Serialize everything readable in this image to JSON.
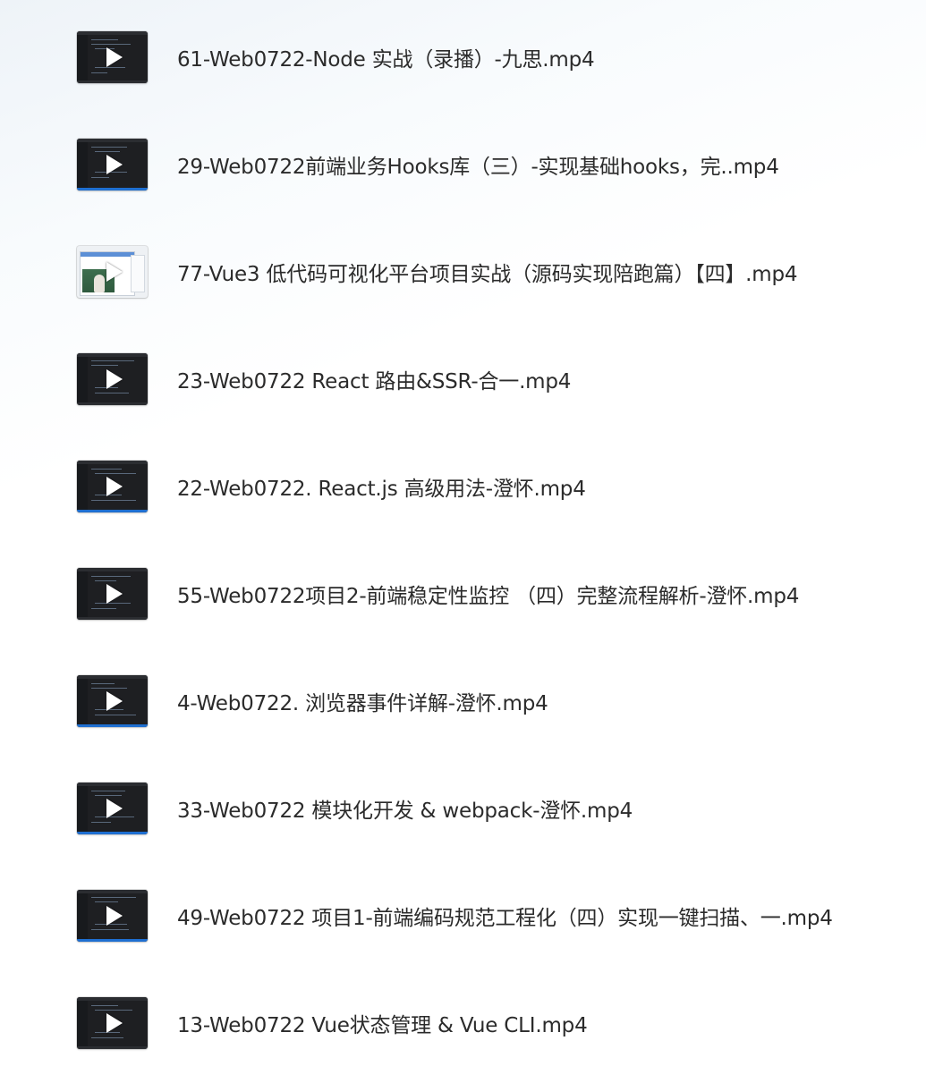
{
  "files": [
    {
      "name": "61-Web0722-Node 实战（录播）-九思.mp4",
      "thumbnail": "code-editor",
      "icon": "play-icon"
    },
    {
      "name": "29-Web0722前端业务Hooks库（三）-实现基础hooks，完..mp4",
      "thumbnail": "code-editor",
      "icon": "play-icon"
    },
    {
      "name": "77-Vue3 低代码可视化平台项目实战（源码实现陪跑篇）【四】.mp4",
      "thumbnail": "browser-with-webcam",
      "icon": "play-icon"
    },
    {
      "name": "23-Web0722 React 路由&SSR-合一.mp4",
      "thumbnail": "code-editor",
      "icon": "play-icon"
    },
    {
      "name": "22-Web0722. React.js 高级用法-澄怀.mp4",
      "thumbnail": "code-editor",
      "icon": "play-icon"
    },
    {
      "name": "55-Web0722项目2-前端稳定性监控 （四）完整流程解析-澄怀.mp4",
      "thumbnail": "code-editor",
      "icon": "play-icon"
    },
    {
      "name": "4-Web0722. 浏览器事件详解-澄怀.mp4",
      "thumbnail": "code-editor",
      "icon": "play-icon"
    },
    {
      "name": "33-Web0722 模块化开发 & webpack-澄怀.mp4",
      "thumbnail": "code-editor",
      "icon": "play-icon"
    },
    {
      "name": "49-Web0722 项目1-前端编码规范工程化（四）实现一键扫描、一.mp4",
      "thumbnail": "code-editor",
      "icon": "play-icon"
    },
    {
      "name": "13-Web0722 Vue状态管理 & Vue CLI.mp4",
      "thumbnail": "code-editor",
      "icon": "play-icon"
    }
  ]
}
